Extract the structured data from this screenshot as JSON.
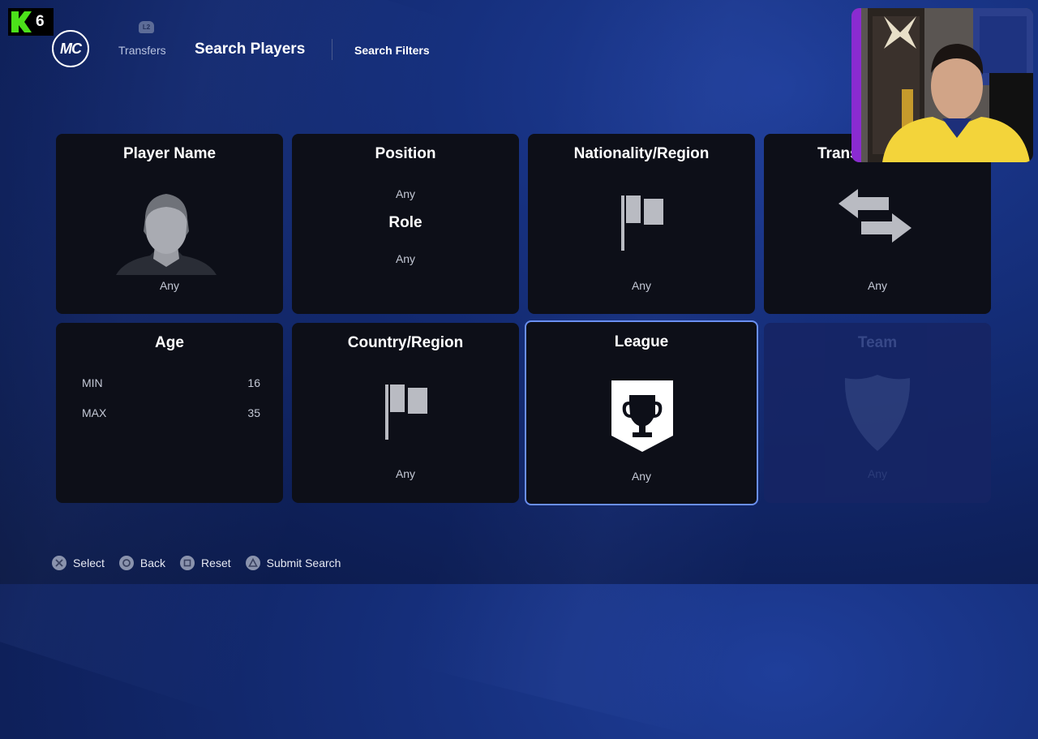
{
  "channel": {
    "number": "6"
  },
  "header": {
    "logo": "MC",
    "bumper_badge": "L2",
    "nav_prev": "Transfers",
    "title": "Search Players",
    "nav_next": "Search Filters"
  },
  "tiles": {
    "player_name": {
      "title": "Player Name",
      "value": "Any"
    },
    "position": {
      "title": "Position",
      "value": "Any",
      "role_title": "Role",
      "role_value": "Any"
    },
    "nationality": {
      "title": "Nationality/Region",
      "value": "Any"
    },
    "transfer": {
      "title": "Trans",
      "value": "Any"
    },
    "age": {
      "title": "Age",
      "min_label": "MIN",
      "min_value": "16",
      "max_label": "MAX",
      "max_value": "35"
    },
    "country": {
      "title": "Country/Region",
      "value": "Any"
    },
    "league": {
      "title": "League",
      "value": "Any"
    },
    "team": {
      "title": "Team",
      "value": "Any"
    }
  },
  "footer": {
    "select": "Select",
    "back": "Back",
    "reset": "Reset",
    "submit": "Submit Search"
  },
  "colors": {
    "background": "#14296f",
    "tile": "#0d0f18",
    "selected_border": "#6a8ff0",
    "channel_green": "#4ce21a"
  }
}
